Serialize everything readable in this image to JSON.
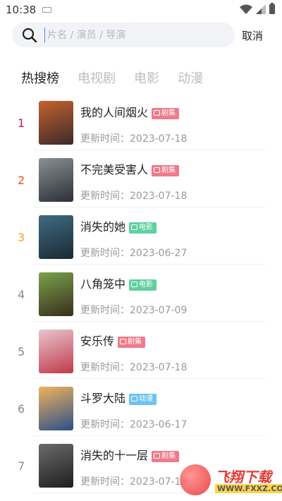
{
  "status": {
    "time": "10:38"
  },
  "search": {
    "placeholder": "片名 / 演员 / 导演",
    "value": "",
    "cancel_label": "取消"
  },
  "tabs": [
    {
      "label": "热搜榜",
      "active": true
    },
    {
      "label": "电视剧",
      "active": false
    },
    {
      "label": "电影",
      "active": false
    },
    {
      "label": "动漫",
      "active": false
    }
  ],
  "update_prefix": "更新时间：",
  "items": [
    {
      "rank": "1",
      "rank_color": "#c2185b",
      "title": "我的人间烟火",
      "badge": "剧集",
      "badge_color": "#ef7b8a",
      "date": "2023-07-18",
      "poster_colors": [
        "#c4622d",
        "#3b2a2a"
      ]
    },
    {
      "rank": "2",
      "rank_color": "#f4511e",
      "title": "不完美受害人",
      "badge": "剧集",
      "badge_color": "#ef7b8a",
      "date": "2023-07-18",
      "poster_colors": [
        "#8a8f96",
        "#2c2f36"
      ]
    },
    {
      "rank": "3",
      "rank_color": "#f6a623",
      "title": "消失的她",
      "badge": "电影",
      "badge_color": "#5fd0a0",
      "date": "2023-06-27",
      "poster_colors": [
        "#3f6a82",
        "#1b2a33"
      ]
    },
    {
      "rank": "4",
      "rank_color": "#8a8a8a",
      "title": "八角笼中",
      "badge": "电影",
      "badge_color": "#5fd0a0",
      "date": "2023-07-09",
      "poster_colors": [
        "#7aa24a",
        "#3a2d1f"
      ]
    },
    {
      "rank": "5",
      "rank_color": "#8a8a8a",
      "title": "安乐传",
      "badge": "剧集",
      "badge_color": "#ef7b8a",
      "date": "2023-07-18",
      "poster_colors": [
        "#e8c6cf",
        "#c0394b"
      ]
    },
    {
      "rank": "6",
      "rank_color": "#8a8a8a",
      "title": "斗罗大陆",
      "badge": "动漫",
      "badge_color": "#6cc3f0",
      "date": "2023-06-17",
      "poster_colors": [
        "#f0b35a",
        "#2b4f8a"
      ]
    },
    {
      "rank": "7",
      "rank_color": "#8a8a8a",
      "title": "消失的十一层",
      "badge": "剧集",
      "badge_color": "#ef7b8a",
      "date": "2023-07-18",
      "poster_colors": [
        "#6b6b6b",
        "#1e1e1e"
      ]
    }
  ],
  "watermark": {
    "text": "飞翔下载",
    "url": "WWW.FXXZ.COM"
  }
}
